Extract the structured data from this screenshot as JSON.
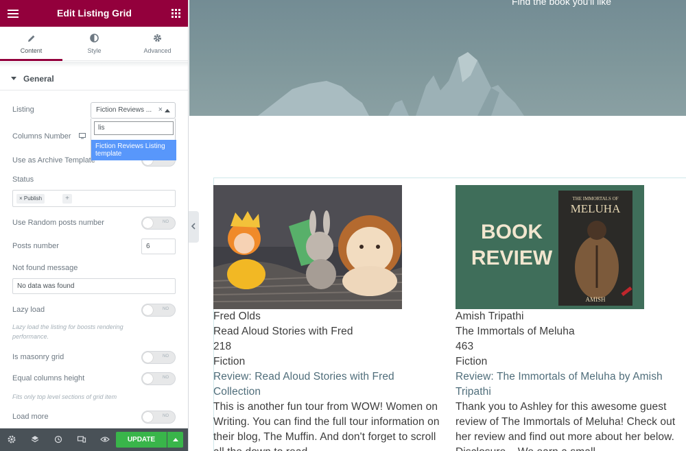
{
  "editor": {
    "title": "Edit Listing Grid",
    "tabs": [
      {
        "label": "Content",
        "icon": "pencil-icon"
      },
      {
        "label": "Style",
        "icon": "contrast-icon"
      },
      {
        "label": "Advanced",
        "icon": "gear-icon"
      }
    ],
    "section": "General",
    "listing": {
      "label": "Listing",
      "value": "Fiction Reviews ...",
      "search_value": "lis",
      "option": "Fiction Reviews Listing template"
    },
    "columns_label": "Columns Number",
    "archive_label": "Use as Archive Template",
    "status_label": "Status",
    "status_tag": "× Publish",
    "random_label": "Use Random posts number",
    "posts_number_label": "Posts number",
    "posts_number_value": "6",
    "not_found_label": "Not found message",
    "not_found_value": "No data was found",
    "lazy_label": "Lazy load",
    "lazy_hint": "Lazy load the listing for boosts rendering performance.",
    "masonry_label": "Is masonry grid",
    "equal_label": "Equal columns height",
    "equal_hint": "Fits only top level sections of grid item",
    "load_more_label": "Load more",
    "toggle_off": "NO",
    "update_label": "UPDATE",
    "colors": {
      "brand": "#93003c",
      "update": "#39b54a",
      "bottombar": "#495157",
      "option": "#5897fb"
    }
  },
  "preview": {
    "hero_text": "Find the book you'll like",
    "cards": [
      {
        "author": "Fred Olds",
        "book": "Read Aloud Stories with Fred",
        "pages": "218",
        "genre": "Fiction",
        "link": "Review: Read Aloud Stories with Fred Collection",
        "excerpt": "This is another fun tour from WOW! Women on Writing. You can find the full tour information on their blog, The Muffin. And don't forget to scroll all the down to read"
      },
      {
        "author": "Amish Tripathi",
        "book": "The Immortals of Meluha",
        "pages": "463",
        "genre": "Fiction",
        "link": "Review: The Immortals of Meluha by Amish Tripathi",
        "excerpt": "Thank you to Ashley for this awesome guest review of The Immortals of Meluha! Check out her review and find out more about her below. Disclosure – We earn a small"
      }
    ],
    "book_cover": {
      "badge_top": "BOOK",
      "badge_bottom": "REVIEW",
      "title_small": "THE IMMORTALS OF",
      "title_big": "MELUHA",
      "author": "AMISH"
    }
  }
}
